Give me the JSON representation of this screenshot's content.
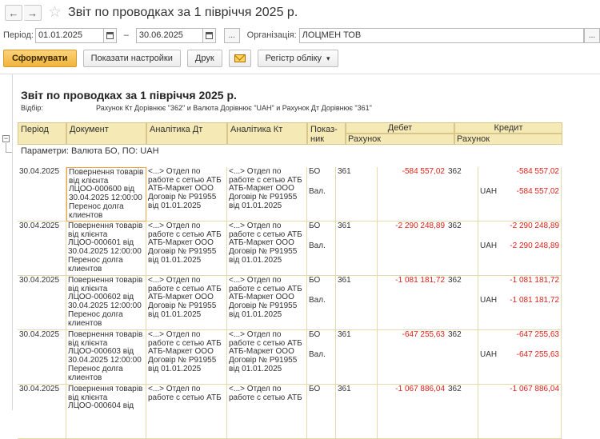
{
  "window": {
    "title": "Звіт по проводках  за 1 півріччя 2025 р.",
    "back_icon": "←",
    "forward_icon": "→",
    "star_icon": "☆"
  },
  "filter": {
    "period_label": "Період:",
    "date_from": "01.01.2025",
    "dash": "–",
    "date_to": "30.06.2025",
    "more_label": "...",
    "org_label": "Організація:",
    "org_value": "ЛОЦМЕН ТОВ"
  },
  "toolbar": {
    "generate_label": "Сформувати",
    "settings_label": "Показати настройки",
    "print_label": "Друк",
    "register_label": "Регістр обліку",
    "dropdown_arrow": "▾"
  },
  "report": {
    "title": "Звіт по проводках за 1 півріччя 2025 р.",
    "selection_label": "Відбір:",
    "selection_text": "Рахунок Кт Дорівнює \"362\" и Валюта Дорівнює \"UAH\" и Рахунок Дт Дорівнює \"361\"",
    "headers": {
      "period": "Період",
      "document": "Документ",
      "analytics_dt": "Аналітика Дт",
      "analytics_kt": "Аналітика Кт",
      "indicator_line1": "Показ-",
      "indicator_line2": "ник",
      "debit": "Дебет",
      "credit": "Кредит",
      "account": "Рахунок"
    },
    "params_text": "Параметри:    Валюта БО, ПО: UAH",
    "rows": [
      {
        "date": "30.04.2025",
        "doc": "Повернення товарів від клієнта ЛЦОО-000600 від 30.04.2025 12:00:00 Перенос долга клиентов",
        "an_dt": "<...> Отдел по работе с сетью АТБ АТБ-Маркет ООО Договір № P91955 від 01.01.2025",
        "an_kt": "<...> Отдел по работе с сетью АТБ АТБ-Маркет ООО Договір № P91955 від 01.01.2025",
        "ind1": "БО",
        "ind2": "Вал.",
        "dt_acc": "361",
        "dt_amount": "-584 557,02",
        "kt_acc": "362",
        "cur": "UAH",
        "kt_amount": "-584 557,02",
        "kt_amount2": "-584 557,02"
      },
      {
        "date": "30.04.2025",
        "doc": "Повернення товарів від клієнта ЛЦОО-000601 від 30.04.2025 12:00:00 Перенос долга клиентов",
        "an_dt": "<...> Отдел по работе с сетью АТБ АТБ-Маркет ООО Договір № P91955 від 01.01.2025",
        "an_kt": "<...> Отдел по работе с сетью АТБ АТБ-Маркет ООО Договір № P91955 від 01.01.2025",
        "ind1": "БО",
        "ind2": "Вал.",
        "dt_acc": "361",
        "dt_amount": "-2 290 248,89",
        "kt_acc": "362",
        "cur": "UAH",
        "kt_amount": "-2 290 248,89",
        "kt_amount2": "-2 290 248,89"
      },
      {
        "date": "30.04.2025",
        "doc": "Повернення товарів від клієнта ЛЦОО-000602 від 30.04.2025 12:00:00 Перенос долга клиентов",
        "an_dt": "<...> Отдел по работе с сетью АТБ АТБ-Маркет ООО Договір № P91955 від 01.01.2025",
        "an_kt": "<...> Отдел по работе с сетью АТБ АТБ-Маркет ООО Договір № P91955 від 01.01.2025",
        "ind1": "БО",
        "ind2": "Вал.",
        "dt_acc": "361",
        "dt_amount": "-1 081 181,72",
        "kt_acc": "362",
        "cur": "UAH",
        "kt_amount": "-1 081 181,72",
        "kt_amount2": "-1 081 181,72"
      },
      {
        "date": "30.04.2025",
        "doc": "Повернення товарів від клієнта ЛЦОО-000603 від 30.04.2025 12:00:00 Перенос долга клиентов",
        "an_dt": "<...> Отдел по работе с сетью АТБ АТБ-Маркет ООО Договір № P91955 від 01.01.2025",
        "an_kt": "<...> Отдел по работе с сетью АТБ АТБ-Маркет ООО Договір № P91955 від 01.01.2025",
        "ind1": "БО",
        "ind2": "Вал.",
        "dt_acc": "361",
        "dt_amount": "-647 255,63",
        "kt_acc": "362",
        "cur": "UAH",
        "kt_amount": "-647 255,63",
        "kt_amount2": "-647 255,63"
      },
      {
        "date": "30.04.2025",
        "doc": "Повернення товарів від клієнта ЛЦОО-000604 від",
        "an_dt": "<...> Отдел по работе с сетью АТБ",
        "an_kt": "<...> Отдел по работе с сетью АТБ",
        "ind1": "БО",
        "ind2": "",
        "dt_acc": "361",
        "dt_amount": "-1 067 886,04",
        "kt_acc": "362",
        "cur": "",
        "kt_amount": "-1 067 886,04",
        "kt_amount2": ""
      }
    ]
  }
}
